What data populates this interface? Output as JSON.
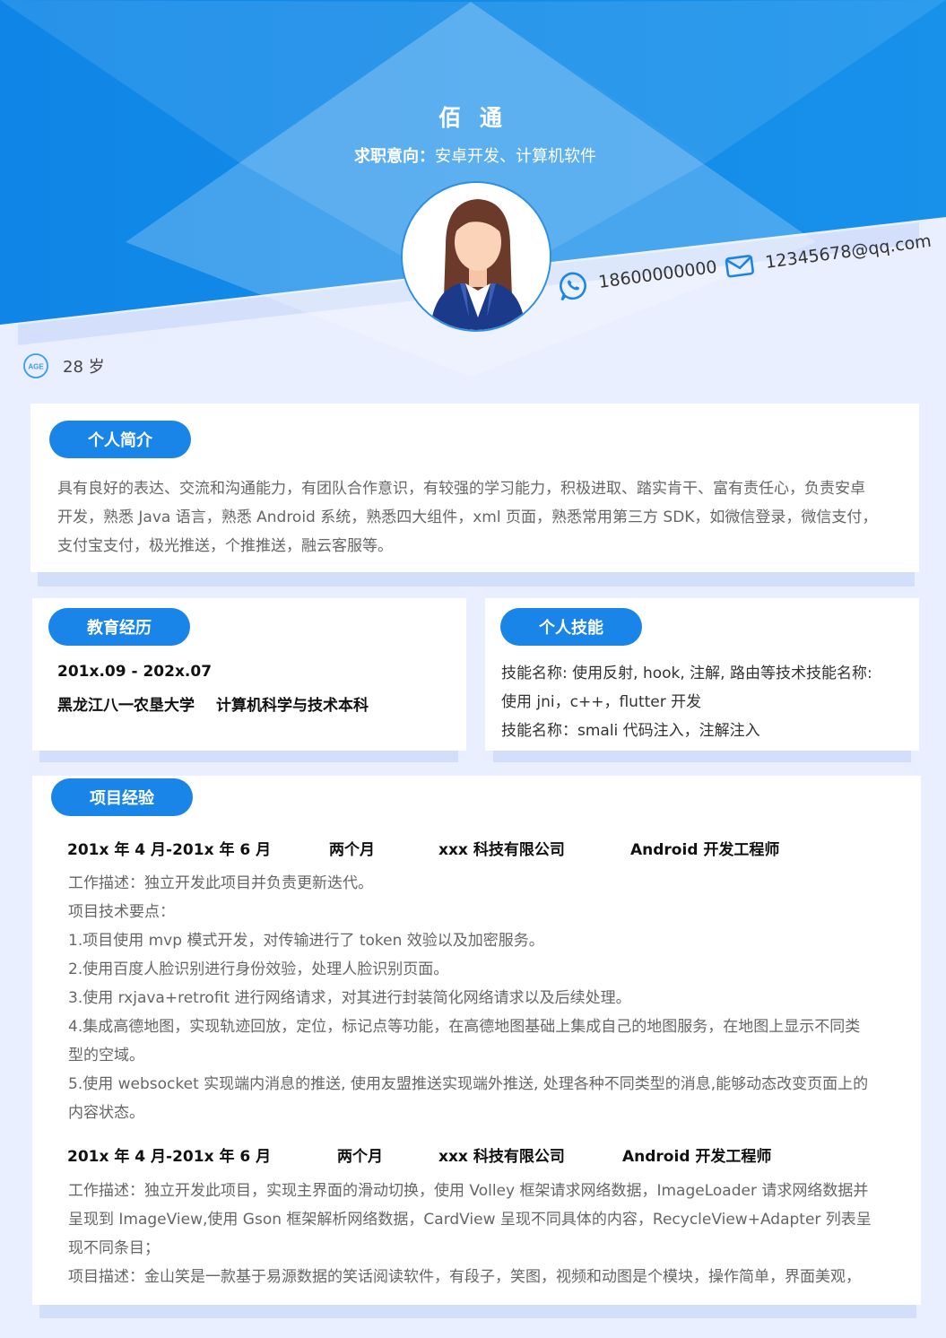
{
  "header": {
    "name": "佰 通",
    "intent_label": "求职意向：",
    "intent_value": "安卓开发、计算机软件",
    "phone": "18600000000",
    "email": "12345678@qq.com",
    "age": "28 岁",
    "age_icon_text": "AGE"
  },
  "colors": {
    "accent": "#1a85e8",
    "header_blue": "#1189e6",
    "page_bg": "#e9efff"
  },
  "profile": {
    "title": "个人简介",
    "lines": [
      "具有良好的表达、交流和沟通能力，有团队合作意识，有较强的学习能力，积极进取、踏实肯干、富有责任心，负责安卓",
      "开发，熟悉 Java 语言，熟悉 Android 系统，熟悉四大组件，xml 页面，熟悉常用第三方 SDK，如微信登录，微信支付，",
      "支付宝支付，极光推送，个推推送，融云客服等。"
    ]
  },
  "education": {
    "title": "教育经历",
    "date": "201x.09 - 202x.07",
    "school": "黑龙江八一农垦大学",
    "major": "计算机科学与技术本科"
  },
  "skills": {
    "title": "个人技能",
    "lines": [
      "技能名称: 使用反射, hook, 注解, 路由等技术技能名称:",
      "使用 jni，c++，flutter 开发",
      "技能名称：smali 代码注入，注解注入"
    ]
  },
  "projects": {
    "title": "项目经验",
    "items": [
      {
        "period": "201x 年 4 月-201x 年 6 月",
        "duration": "两个月",
        "company": "xxx 科技有限公司",
        "role": "Android 开发工程师",
        "lines": [
          "工作描述：独立开发此项目并负责更新迭代。",
          "项目技术要点：",
          "1.项目使用 mvp 模式开发，对传输进行了 token 效验以及加密服务。",
          "2.使用百度人脸识别进行身份效验，处理人脸识别页面。",
          "3.使用 rxjava+retrofit 进行网络请求，对其进行封装简化网络请求以及后续处理。",
          "4.集成高德地图，实现轨迹回放，定位，标记点等功能，在高德地图基础上集成自己的地图服务，在地图上显示不同类",
          "型的空域。",
          "5.使用 websocket 实现端内消息的推送, 使用友盟推送实现端外推送, 处理各种不同类型的消息,能够动态改变页面上的",
          "内容状态。"
        ]
      },
      {
        "period": "201x 年 4 月-201x 年 6 月",
        "duration": "两个月",
        "company": "xxx 科技有限公司",
        "role": "Android 开发工程师",
        "lines": [
          "工作描述：独立开发此项目，实现主界面的滑动切换，使用 Volley 框架请求网络数据，ImageLoader 请求网络数据并",
          "呈现到 ImageView,使用 Gson 框架解析网络数据，CardView 呈现不同具体的内容，RecycleView+Adapter 列表呈",
          "现不同条目；",
          "项目描述：金山笑是一款基于易源数据的笑话阅读软件，有段子，笑图，视频和动图是个模块，操作简单，界面美观，"
        ]
      }
    ]
  }
}
